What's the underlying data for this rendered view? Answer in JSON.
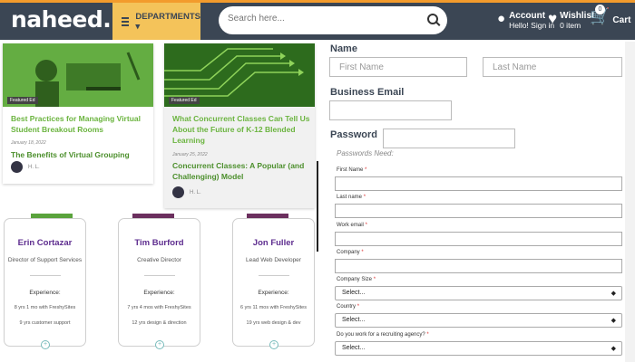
{
  "header": {
    "logo": "naheed.pk",
    "departments_label": "DEPARTMENTS ▾",
    "search_placeholder": "Search here...",
    "account_title": "Account",
    "account_sub": "Hello! Sign in",
    "wishlist_title": "Wishlist",
    "wishlist_sub": "0 item",
    "cart_count": "0",
    "cart_label": "Cart"
  },
  "articles": [
    {
      "tag": "Featured Ed",
      "title": "Best Practices for Managing Virtual Student Breakout Rooms",
      "date": "January 18, 2022",
      "subtitle": "The Benefits of Virtual Grouping",
      "author": "H. L."
    },
    {
      "tag": "Featured Ed",
      "title": "What Concurrent Classes Can Tell Us About the Future of K-12 Blended Learning",
      "date": "January 25, 2022",
      "subtitle": "Concurrent Classes: A Popular (and Challenging) Model",
      "author": "H. L."
    }
  ],
  "people": [
    {
      "name": "Erin Cortazar",
      "role": "Director of Support Services",
      "exp_label": "Experience:",
      "line1": "8 yrs 1 mo with FreshySites",
      "line2": "9 yrs customer support"
    },
    {
      "name": "Tim Burford",
      "role": "Creative Director",
      "exp_label": "Experience:",
      "line1": "7 yrs 4 mos with FreshySites",
      "line2": "12 yrs design & direction"
    },
    {
      "name": "Jon Fuller",
      "role": "Lead Web Developer",
      "exp_label": "Experience:",
      "line1": "6 yrs 11 mos with FreshySites",
      "line2": "19 yrs web design & dev"
    }
  ],
  "form": {
    "name_label": "Name",
    "first_name_placeholder": "First Name",
    "last_name_placeholder": "Last Name",
    "email_label": "Business Email",
    "password_label": "Password",
    "password_needs": "Passwords Need:",
    "small_first_name": "First Name",
    "small_last_name": "Last name",
    "small_work_email": "Work email",
    "small_company": "Company",
    "small_company_size": "Company Size",
    "small_country": "Country",
    "small_recruiting": "Do you work for a recruiting agency?",
    "required_mark": "*",
    "select_placeholder": "Select..."
  },
  "colors": {
    "header_bg": "#3b4654",
    "accent_orange": "#f39b2c",
    "departments_bg": "#f4c35a",
    "article_green": "#6bb43f",
    "person_purple": "#5e2d8f"
  }
}
